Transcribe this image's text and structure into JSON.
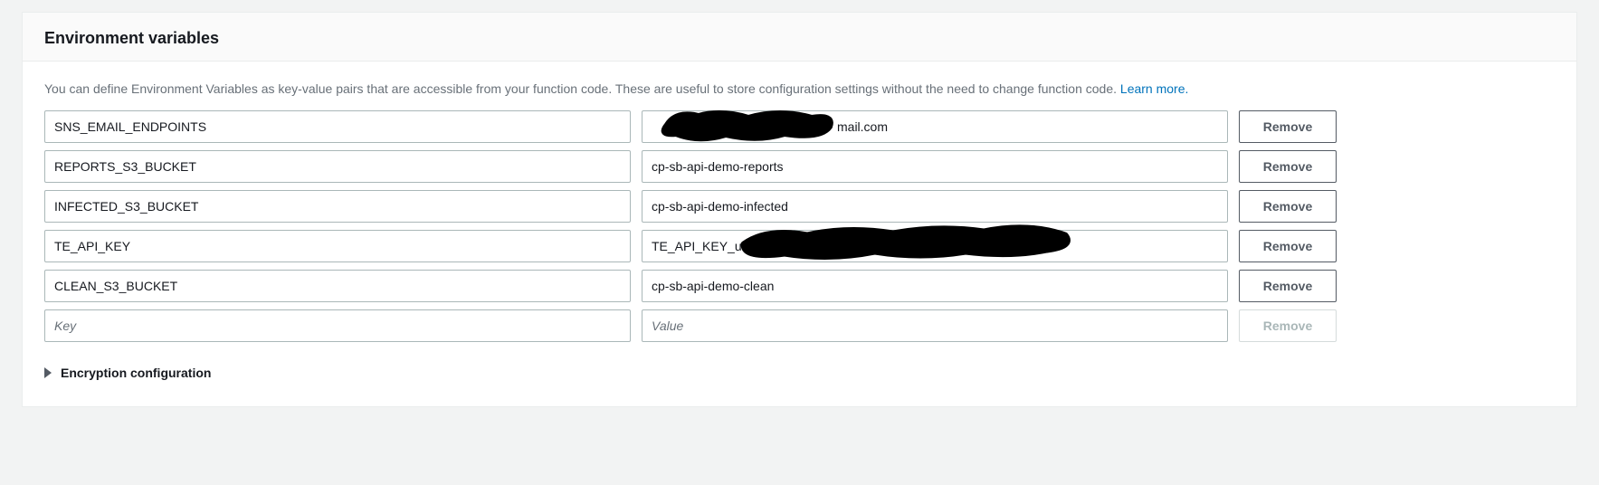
{
  "panel": {
    "title": "Environment variables",
    "description_prefix": "You can define Environment Variables as key-value pairs that are accessible from your function code. These are useful to store configuration settings without the need to change function code. ",
    "learn_more_label": "Learn more."
  },
  "buttons": {
    "remove_label": "Remove"
  },
  "placeholders": {
    "key": "Key",
    "value": "Value"
  },
  "rows": [
    {
      "key": "SNS_EMAIL_ENDPOINTS",
      "value": "mail.com",
      "redacted": "row0"
    },
    {
      "key": "REPORTS_S3_BUCKET",
      "value": "cp-sb-api-demo-reports",
      "redacted": null
    },
    {
      "key": "INFECTED_S3_BUCKET",
      "value": "cp-sb-api-demo-infected",
      "redacted": null
    },
    {
      "key": "TE_API_KEY",
      "value": "TE_API_KEY_u",
      "redacted": "row3"
    },
    {
      "key": "CLEAN_S3_BUCKET",
      "value": "cp-sb-api-demo-clean",
      "redacted": null
    }
  ],
  "expander": {
    "label": "Encryption configuration"
  }
}
